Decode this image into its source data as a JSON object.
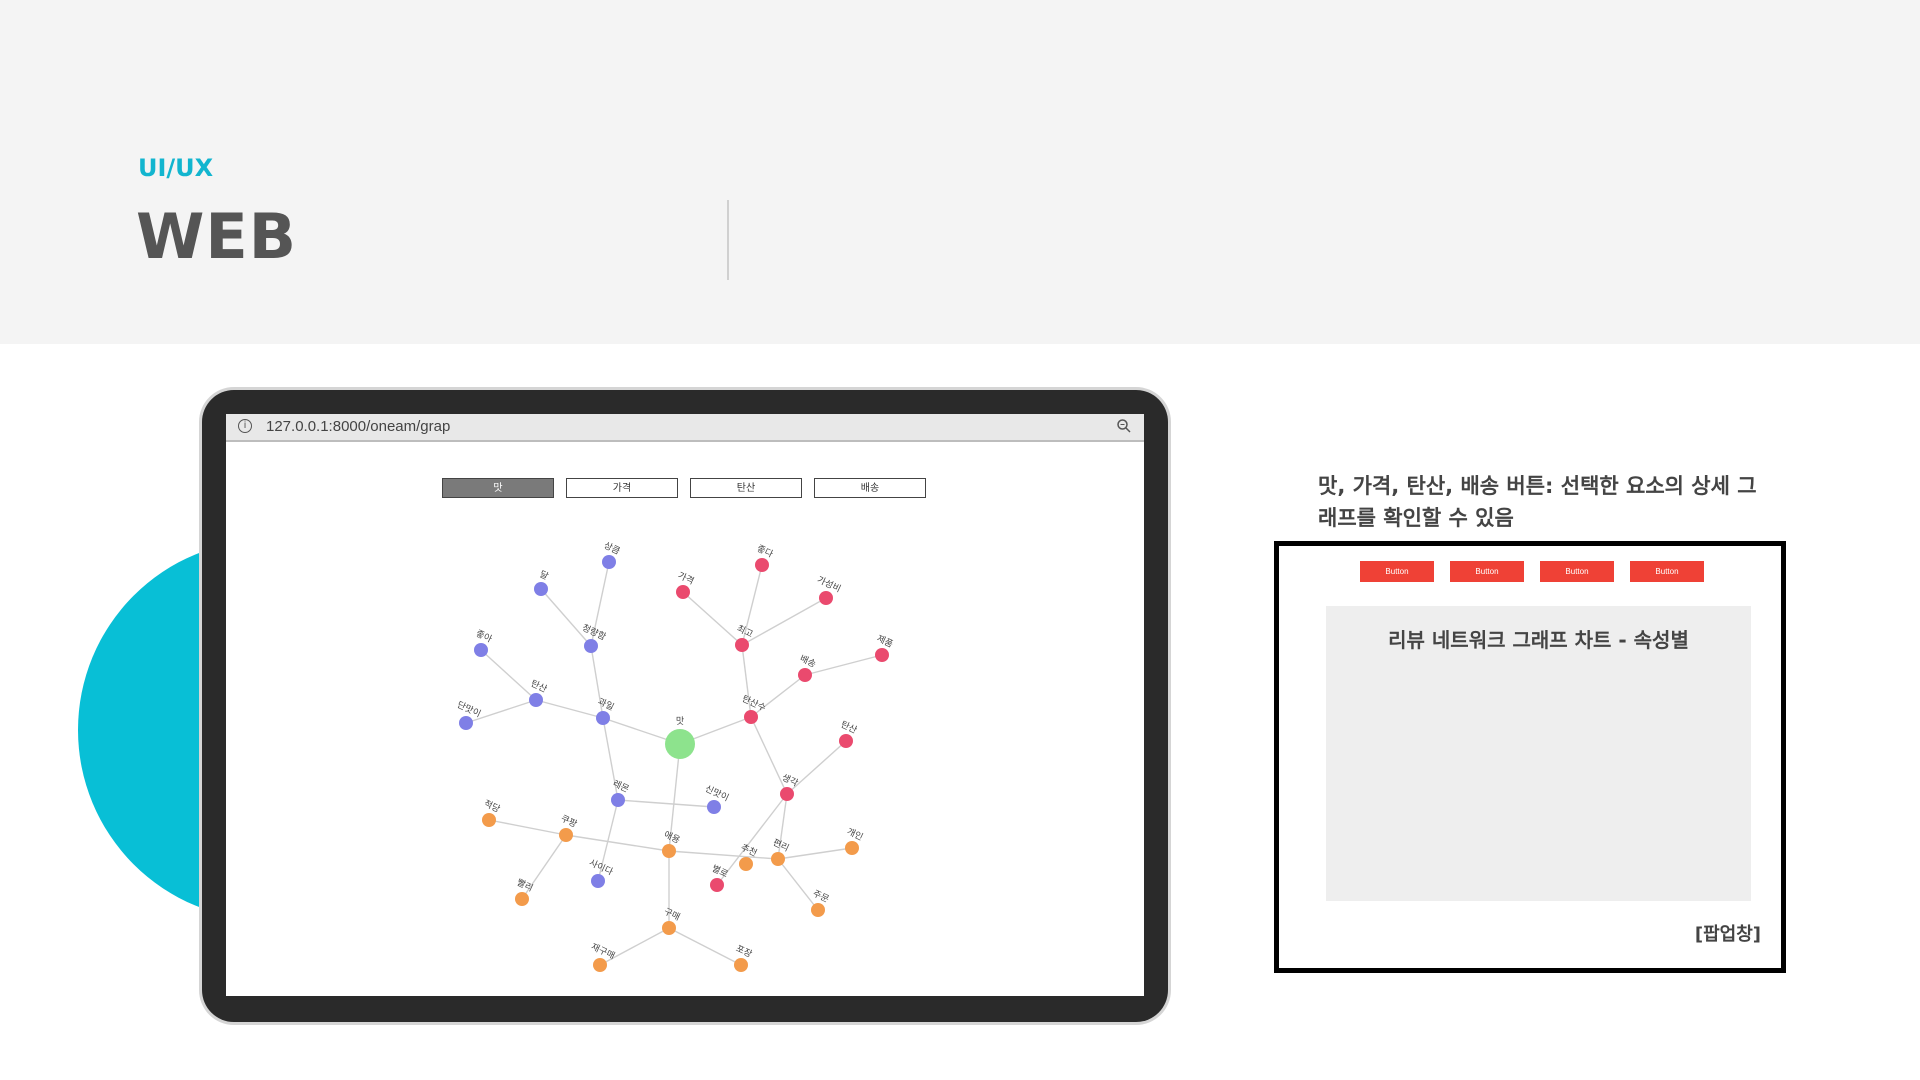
{
  "header": {
    "section_label": "UI/UX",
    "title": "WEB"
  },
  "browser": {
    "url": "127.0.0.1:8000/oneam/grap",
    "info_icon": "info-icon",
    "zoom_icon": "zoom-icon"
  },
  "tabs": [
    {
      "label": "맛",
      "active": true
    },
    {
      "label": "가격",
      "active": false
    },
    {
      "label": "탄산",
      "active": false
    },
    {
      "label": "배송",
      "active": false
    }
  ],
  "graph": {
    "colors": {
      "root": "#8de38d",
      "blue": "#7f7fe6",
      "pink": "#ea4a6e",
      "orange": "#f39b4b",
      "edge": "#cfcfcf"
    },
    "nodes": [
      {
        "id": "root",
        "label": "맛",
        "group": "root"
      },
      {
        "id": "b1",
        "label": "상큼",
        "group": "blue"
      },
      {
        "id": "b2",
        "label": "달",
        "group": "blue"
      },
      {
        "id": "b3",
        "label": "청량함",
        "group": "blue"
      },
      {
        "id": "b4",
        "label": "좋아",
        "group": "blue"
      },
      {
        "id": "b5",
        "label": "탄산",
        "group": "blue"
      },
      {
        "id": "b6",
        "label": "단맛이",
        "group": "blue"
      },
      {
        "id": "b7",
        "label": "과일",
        "group": "blue"
      },
      {
        "id": "b8",
        "label": "레몬",
        "group": "blue"
      },
      {
        "id": "b9",
        "label": "신맛이",
        "group": "blue"
      },
      {
        "id": "b10",
        "label": "사이다",
        "group": "blue"
      },
      {
        "id": "p1",
        "label": "가격",
        "group": "pink"
      },
      {
        "id": "p2",
        "label": "좋다",
        "group": "blue_pink"
      },
      {
        "id": "p3",
        "label": "가성비",
        "group": "pink"
      },
      {
        "id": "p4",
        "label": "최고",
        "group": "pink"
      },
      {
        "id": "p5",
        "label": "배송",
        "group": "pink"
      },
      {
        "id": "p6",
        "label": "제품",
        "group": "pink"
      },
      {
        "id": "p7",
        "label": "탄산수",
        "group": "pink"
      },
      {
        "id": "p8",
        "label": "탄산",
        "group": "pink"
      },
      {
        "id": "p9",
        "label": "생각",
        "group": "pink"
      },
      {
        "id": "p10",
        "label": "별로",
        "group": "pink"
      },
      {
        "id": "o1",
        "label": "적당",
        "group": "orange"
      },
      {
        "id": "o2",
        "label": "쿠팡",
        "group": "orange"
      },
      {
        "id": "o3",
        "label": "빨리",
        "group": "orange"
      },
      {
        "id": "o4",
        "label": "애용",
        "group": "orange"
      },
      {
        "id": "o5",
        "label": "구매",
        "group": "orange"
      },
      {
        "id": "o6",
        "label": "개인",
        "group": "orange"
      },
      {
        "id": "o7",
        "label": "편리",
        "group": "orange"
      },
      {
        "id": "o8",
        "label": "주문",
        "group": "orange"
      },
      {
        "id": "o9",
        "label": "재구매",
        "group": "orange"
      },
      {
        "id": "o10",
        "label": "포장",
        "group": "orange"
      },
      {
        "id": "o11",
        "label": "추천",
        "group": "orange"
      }
    ]
  },
  "description": "맛, 가격, 탄산, 배송 버튼: 선택한 요소의 상세 그래프를 확인할 수 있음",
  "popup": {
    "buttons": [
      "Button",
      "Button",
      "Button",
      "Button"
    ],
    "chart_title": "리뷰 네트워크 그래프 차트 - 속성별",
    "caption": "[팝업창]"
  }
}
